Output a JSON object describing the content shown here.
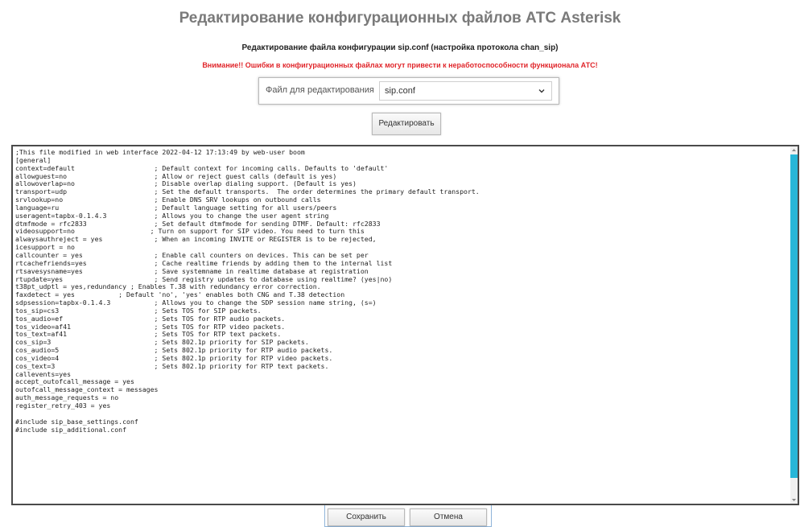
{
  "header": {
    "title": "Редактирование конфигурационных файлов АТС Asterisk",
    "subtitle": "Редактирование файла конфигурации sip.conf (настройка протокола chan_sip)",
    "warning": "Внимание!! Ошибки в конфигурационных файлах могут привести к неработоспособности функционала АТС!"
  },
  "file_selector": {
    "label": "Файл для редактирования",
    "value": "sip.conf"
  },
  "buttons": {
    "edit": "Редактировать",
    "save": "Сохранить",
    "cancel": "Отмена"
  },
  "editor": {
    "content": ";This file modified in web interface 2022-04-12 17:13:49 by web-user boom\n[general]\ncontext=default                    ; Default context for incoming calls. Defaults to 'default'\nallowguest=no                      ; Allow or reject guest calls (default is yes)\nallowoverlap=no                    ; Disable overlap dialing support. (Default is yes)\ntransport=udp                      ; Set the default transports.  The order determines the primary default transport.\nsrvlookup=no                       ; Enable DNS SRV lookups on outbound calls\nlanguage=ru                        ; Default language setting for all users/peers\nuseragent=tapbx-0.1.4.3            ; Allows you to change the user agent string\ndtmfmode = rfc2833                 ; Set default dtmfmode for sending DTMF. Default: rfc2833\nvideosupport=no                   ; Turn on support for SIP video. You need to turn this\nalwaysauthreject = yes             ; When an incoming INVITE or REGISTER is to be rejected,\nicesupport = no\ncallcounter = yes                  ; Enable call counters on devices. This can be set per\nrtcachefriends=yes                 ; Cache realtime friends by adding them to the internal list\nrtsavesysname=yes                  ; Save systemname in realtime database at registration\nrtupdate=yes                       ; Send registry updates to database using realtime? (yes|no)\nt38pt_udptl = yes,redundancy ; Enables T.38 with redundancy error correction.\nfaxdetect = yes           ; Default 'no', 'yes' enables both CNG and T.38 detection\nsdpsession=tapbx-0.1.4.3           ; Allows you to change the SDP session name string, (s=)\ntos_sip=cs3                        ; Sets TOS for SIP packets.\ntos_audio=ef                       ; Sets TOS for RTP audio packets.\ntos_video=af41                     ; Sets TOS for RTP video packets.\ntos_text=af41                      ; Sets TOS for RTP text packets.\ncos_sip=3                          ; Sets 802.1p priority for SIP packets.\ncos_audio=5                        ; Sets 802.1p priority for RTP audio packets.\ncos_video=4                        ; Sets 802.1p priority for RTP video packets.\ncos_text=3                         ; Sets 802.1p priority for RTP text packets.\ncallevents=yes\naccept_outofcall_message = yes\noutofcall_message_context = messages\nauth_message_requests = no\nregister_retry_403 = yes\n\n#include sip_base_settings.conf\n#include sip_additional.conf"
  }
}
